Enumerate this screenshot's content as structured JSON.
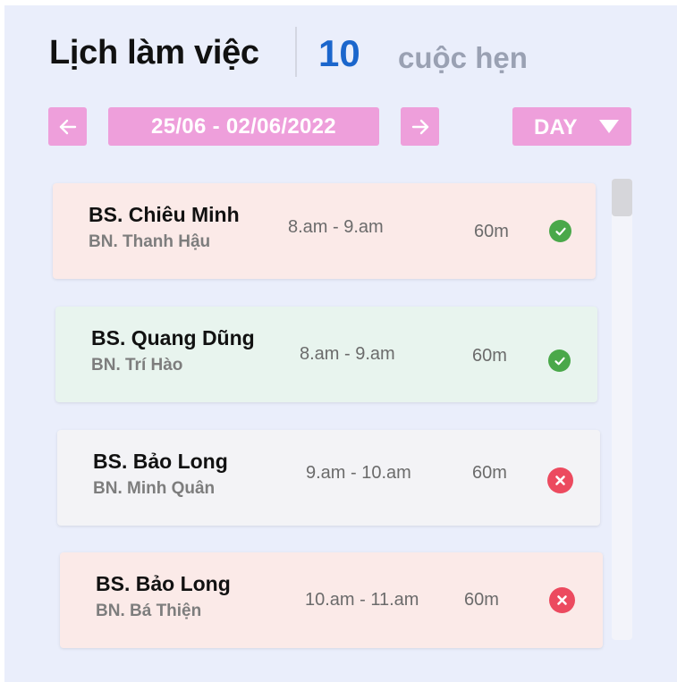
{
  "header": {
    "title": "Lịch làm việc",
    "count": "10",
    "count_label": "cuộc hẹn"
  },
  "toolbar": {
    "date_range": "25/06  -  02/06/2022",
    "view": "DAY",
    "prev_icon": "arrow-left-icon",
    "next_icon": "arrow-right-icon",
    "caret_icon": "caret-down-icon"
  },
  "appointments": [
    {
      "doctor": "BS. Chiêu Minh",
      "patient": "BN. Thanh Hậu",
      "time": "8.am  -  9.am",
      "duration": "60m",
      "status": "confirmed",
      "status_icon": "check-circle-icon",
      "color": "#fbeae8"
    },
    {
      "doctor": "BS. Quang Dũng",
      "patient": "BN. Trí Hào",
      "time": "8.am  -  9.am",
      "duration": "60m",
      "status": "confirmed",
      "status_icon": "check-circle-icon",
      "color": "#e8f4ee"
    },
    {
      "doctor": "BS. Bảo Long",
      "patient": "BN. Minh Quân",
      "time": "9.am  -  10.am",
      "duration": "60m",
      "status": "cancelled",
      "status_icon": "x-circle-icon",
      "color": "#f3f3f6"
    },
    {
      "doctor": "BS.  Bảo Long",
      "patient": "BN. Bá Thiện",
      "time": "10.am  -  11.am",
      "duration": "60m",
      "status": "cancelled",
      "status_icon": "x-circle-icon",
      "color": "#fbeae8"
    }
  ],
  "colors": {
    "accent_pink": "#ee9fdb",
    "count_blue": "#1b66cc",
    "ok_green": "#4aa84a",
    "fail_red": "#ec4a5f"
  }
}
